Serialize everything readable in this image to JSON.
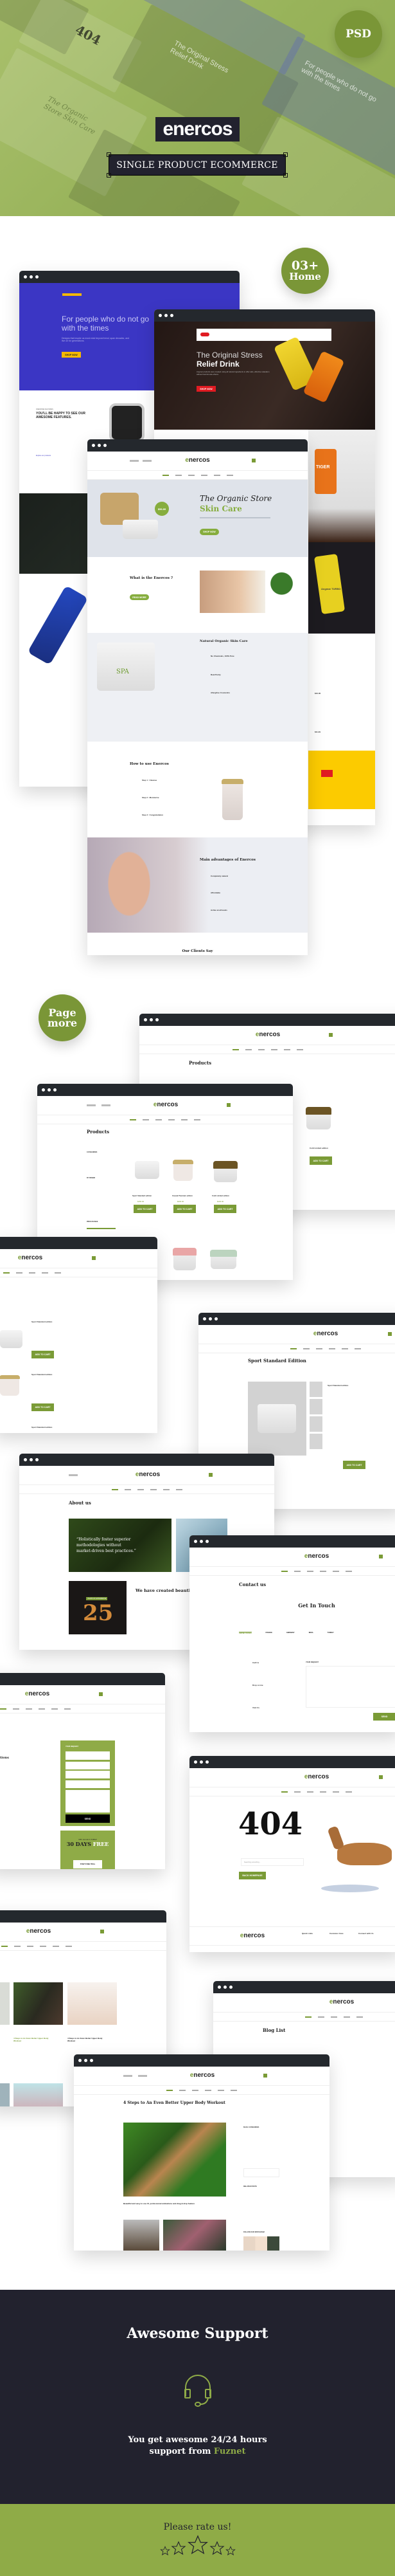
{
  "hero": {
    "brand": "enercos",
    "tagline": "SINGLE PRODUCT ECOMMERCE",
    "format_badge": "PSD",
    "bg_ghost_texts": [
      "404",
      "The Original Stress Relief Drink",
      "The Organic Store Skin Care",
      "For people who do not go with the times"
    ]
  },
  "home_badge": {
    "line1": "03+",
    "line2": "Home"
  },
  "pages_badge": {
    "line1": "Page",
    "line2": "more"
  },
  "colors": {
    "accent": "#7a9b36",
    "dark": "#22222e",
    "rate_bg": "#8fab47",
    "window_bar": "#24282d",
    "blue_theme": "#3b36c4",
    "red_theme": "#e01b22"
  },
  "home_blue": {
    "hero_title": "For people who do not go with the times",
    "hero_sub": "Designs that inspire us most exist beyond trend, span decades, and live on for generations.",
    "cta": "SHOP NOW",
    "features_kicker": "AWESOME FEATURES",
    "features_title": "YOU'LL BE HAPPY TO SEE OUR AWESOME FEATURES.",
    "features_link": "Explore our products"
  },
  "home_red": {
    "hero_line1": "The Original Stress",
    "hero_line2": "Relief Drink",
    "hero_sub": "Angmar products were created using all natural ingredients to offer safe, effective relaxation without harmful side effects.",
    "cta": "SHOP NOW",
    "features": [
      "Maximum Energy",
      "Smart Organic",
      "Milliliters",
      "Calories"
    ],
    "can_brand": "TIGER",
    "can_sub": "Angmar TURBO",
    "product_prices": [
      "$10.00",
      "$11.29"
    ]
  },
  "home_organic": {
    "hero_line1": "The Organic Store",
    "hero_line2": "Skin Care",
    "price_tag": "$56.89",
    "cta": "SHOP NOW",
    "what_is": "What is the Enercos ?",
    "read_more": "READ MORE",
    "natural": "Natural Organic Skin Care",
    "natural_items": [
      "No Chemicals, 100% Pure",
      "Real Purity",
      "Allergfree Cosmetics"
    ],
    "how_to": "How to use Enercos",
    "steps": [
      "Step 1 : Cleanse",
      "Step 2 : Moisturize",
      "Step 3 : Congratulation"
    ],
    "advantages": "Main advantages of Enercos",
    "advantage_items": [
      "Completely natural",
      "Affordable",
      "Active at all levels"
    ],
    "clients": "Our Clients Say",
    "jar_label": "SPA"
  },
  "pages": {
    "products": {
      "title": "Products",
      "categories_head": "CATEGORIES",
      "brand_head": "BY BRAND",
      "price_head": "PRICE RANGE",
      "items": [
        {
          "name": "Sport Standard edition",
          "price": "$150.00"
        },
        {
          "name": "Casual Premium edition",
          "price": "$200.00"
        },
        {
          "name": "Cold Limited edition",
          "price": "$100.00"
        }
      ],
      "add_to_cart": "ADD TO CART"
    },
    "list": {
      "items": [
        "Sport Standard edition",
        "Sport Standard edition",
        "Sport Standard edition"
      ],
      "add_to_cart": "ADD TO CART"
    },
    "detail": {
      "title": "Sport Standard Edition",
      "name": "Sport Standard edition",
      "add_to_cart": "ADD TO CART"
    },
    "about": {
      "title": "About us",
      "quote": "“Holistically foster superior methodologies without market-driven best practices.”",
      "years": "25",
      "years_label": "YEARS OF EXPERIENCE",
      "headline": "We have created beautifull p"
    },
    "contact": {
      "title": "Contact us",
      "get_in_touch": "Get In Touch",
      "tabs": [
        "UNITED STATES",
        "FRANCE",
        "GERMANY",
        "INDIA",
        "TURKEY",
        "JAPAN"
      ],
      "info": [
        "Call Us",
        "Drop a Line",
        "Visit Us"
      ],
      "form_head": "YOUR REQUEST",
      "send": "SEND"
    },
    "faq": {
      "title_tail": "tions",
      "form_head": "YOUR REQUEST",
      "send": "SEND",
      "promo_kicker": "TRY SCOUT FIRST",
      "promo_big": "30 DAYS",
      "promo_free": "FREE",
      "promo_cta": "START FREE TRIAL"
    },
    "notfound": {
      "code": "404",
      "cta": "BACK HOMEPAGE",
      "search_placeholder": "Searching something...",
      "footer_cols": [
        "Quick Links",
        "Customer Care",
        "Connect with Us"
      ]
    },
    "blog_grid": {
      "posts": [
        {
          "title": "4 Steps to An Even Better Upper Body Workout"
        },
        {
          "title": "4 Steps to An Even Better Upper Body Workout"
        }
      ]
    },
    "blog_list": {
      "title": "Blog List"
    },
    "blog_detail": {
      "title": "4 Steps to An Even Better Upper Body Workout",
      "lead": "Beautiful and easy to use UI, professional animations and drag & drop feature",
      "sidebar": [
        "BLOG CATEGORIES",
        "RELATED POSTS",
        "FOLLOW OUR INSTAGRAM"
      ]
    }
  },
  "support": {
    "title": "Awesome Support",
    "text_line1": "You get awesome 24/24 hours",
    "text_line2_prefix": "support from ",
    "brand": "Fuznet",
    "icon": "headset-icon"
  },
  "rating": {
    "label": "Please rate us!",
    "stars": 5,
    "filled": 0
  }
}
